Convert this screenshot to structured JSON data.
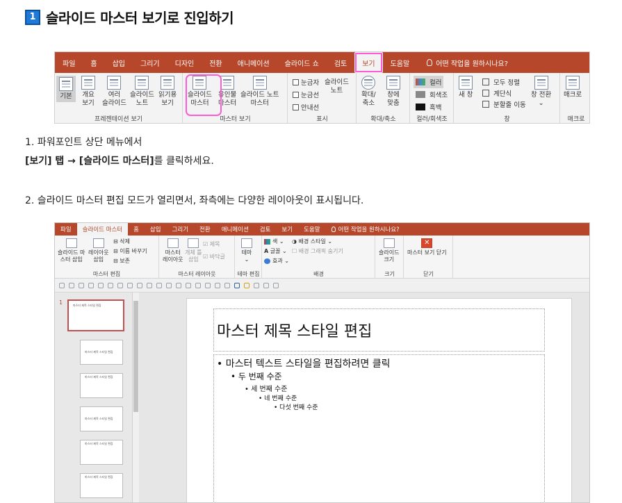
{
  "heading": {
    "number": "1",
    "text": "슬라이드 마스터 보기로 진입하기"
  },
  "ribbon1": {
    "tabs": [
      "파일",
      "홈",
      "삽입",
      "그리기",
      "디자인",
      "전환",
      "애니메이션",
      "슬라이드 쇼",
      "검토",
      "보기",
      "도움말"
    ],
    "tell_me": "어떤 작업을 원하시나요?",
    "buttons": {
      "normal": "기본",
      "outline1": "개요",
      "outline2": "보기",
      "sorter1": "여러",
      "sorter2": "슬라이드",
      "notes1": "슬라이드",
      "notes2": "노트",
      "reading1": "읽기용",
      "reading2": "보기",
      "master1": "슬라이드",
      "master2": "마스터",
      "handout1": "유인물",
      "handout2": "마스터",
      "notesmaster1": "슬라이드 노트",
      "notesmaster2": "마스터",
      "ruler": "눈금자",
      "gridlines": "눈금선",
      "guides": "안내선",
      "shownotes1": "슬라이드",
      "shownotes2": "노트",
      "zoom1": "확대/",
      "zoom2": "축소",
      "fit1": "창에",
      "fit2": "맞춤",
      "color": "컬러",
      "grayscale": "회색조",
      "bw": "흑백",
      "newwin": "새 창",
      "arrange": "모두 정렬",
      "cascade": "계단식",
      "split": "분할줄 이동",
      "switch1": "창 전환",
      "switch2": "⌄",
      "macro": "매크로"
    },
    "groups": {
      "presentation": "프레젠테이션 보기",
      "master": "마스터 보기",
      "show": "표시",
      "zoom": "확대/축소",
      "color": "컬러/회색조",
      "window": "창",
      "macro": "매크로"
    }
  },
  "steps": {
    "s1a": "1. 파워포인트 상단 메뉴에서",
    "s1b_bold": "[보기] 탭 → [슬라이드 마스터]",
    "s1b_rest": "를 클릭하세요.",
    "s2": "2. 슬라이드 마스터 편집 모드가 열리면서, 좌측에는 다양한 레이아웃이 표시됩니다."
  },
  "ribbon2": {
    "tabs": [
      "파일",
      "슬라이드 마스터",
      "홈",
      "삽입",
      "그리기",
      "전환",
      "애니메이션",
      "검토",
      "보기",
      "도움말"
    ],
    "tell_me": "어떤 작업을 원하시나요?",
    "buttons": {
      "insert_master1": "슬라이드 마",
      "insert_master2": "스터 삽입",
      "insert_layout1": "레이아웃",
      "insert_layout2": "삽입",
      "delete": "삭제",
      "rename": "이름 바꾸기",
      "preserve": "보존",
      "master_layout1": "마스터",
      "master_layout2": "레이아웃",
      "insert_ph1": "개체 틀",
      "insert_ph2": "삽입",
      "title": "제목",
      "footer": "바닥글",
      "theme": "테마",
      "colors": "색",
      "fonts": "글꼴",
      "effects": "효과",
      "bg_styles": "배경 스타일",
      "hide_bg": "배경 그래픽 숨기기",
      "slide_size1": "슬라이드",
      "slide_size2": "크기",
      "close": "마스터 보기 닫기"
    },
    "groups": {
      "edit_master": "마스터 편집",
      "master_layout": "마스터 레이아웃",
      "edit_theme": "테마 편집",
      "background": "배경",
      "size": "크기",
      "close": "닫기"
    }
  },
  "slide_pane": {
    "first_index": "1",
    "thumb_title": "마스터 제목 스타일 편집"
  },
  "slide": {
    "title": "마스터 제목 스타일 편집",
    "l1": "• 마스터 텍스트 스타일을 편집하려면 클릭",
    "l2": "• 두 번째 수준",
    "l3": "• 세 번째 수준",
    "l4": "• 네 번째 수준",
    "l5": "• 다섯 번째 수준"
  },
  "colors": {
    "accent": "#b7472a",
    "highlight": "#ff5bd6",
    "badge": "#1f79d6"
  }
}
